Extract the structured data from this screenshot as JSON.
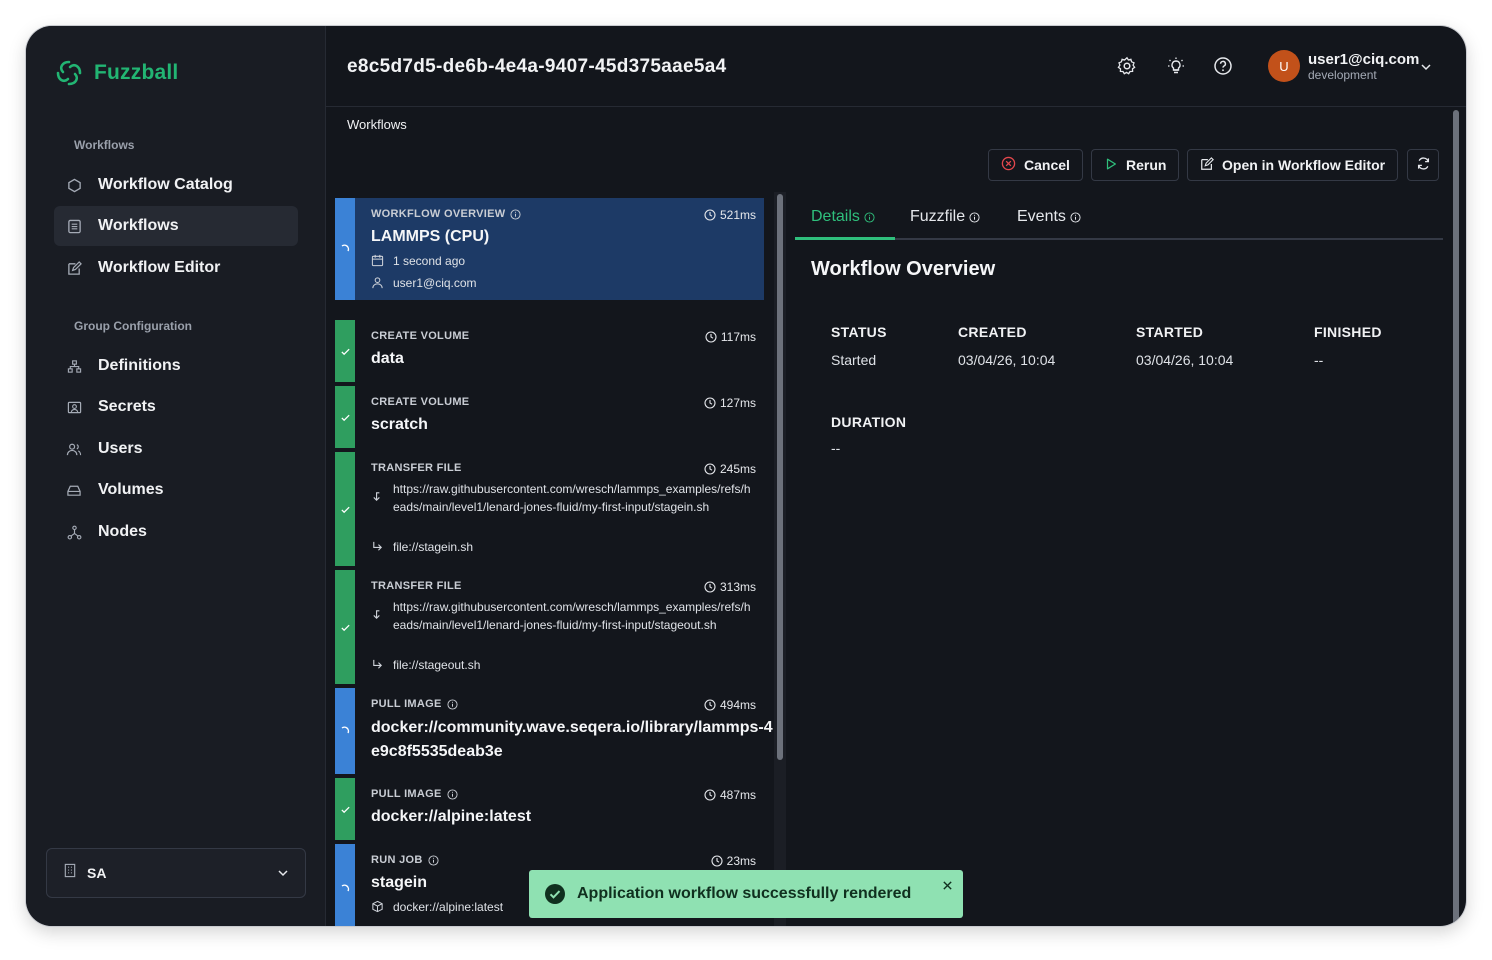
{
  "app": {
    "name": "Fuzzball",
    "brand_color": "#22b573"
  },
  "sidebar": {
    "section_workflows": "Workflows",
    "section_group": "Group Configuration",
    "items": [
      {
        "label": "Workflow Catalog",
        "icon": "hexagon-icon"
      },
      {
        "label": "Workflows",
        "icon": "list-icon",
        "active": true
      },
      {
        "label": "Workflow Editor",
        "icon": "edit-icon"
      },
      {
        "label": "Definitions",
        "icon": "sitemap-icon"
      },
      {
        "label": "Secrets",
        "icon": "secret-icon"
      },
      {
        "label": "Users",
        "icon": "users-icon"
      },
      {
        "label": "Volumes",
        "icon": "hard-drive-icon"
      },
      {
        "label": "Nodes",
        "icon": "nodes-icon"
      }
    ],
    "org": {
      "label": "SA"
    }
  },
  "header": {
    "run_id": "e8c5d7d5-de6b-4e4a-9407-45d375aae5a4",
    "user": {
      "initial": "U",
      "email": "user1@ciq.com",
      "env": "development",
      "avatar_color": "#c2511a"
    }
  },
  "breadcrumb": "Workflows",
  "toolbar": {
    "cancel": "Cancel",
    "rerun": "Rerun",
    "open_editor": "Open in Workflow Editor"
  },
  "steps": [
    {
      "type": "WORKFLOW OVERVIEW",
      "duration": "521ms",
      "title": "LAMMPS (CPU)",
      "created": "1 second ago",
      "user": "user1@ciq.com",
      "status": "running"
    },
    {
      "type": "CREATE VOLUME",
      "duration": "117ms",
      "title": "data",
      "status": "done"
    },
    {
      "type": "CREATE VOLUME",
      "duration": "127ms",
      "title": "scratch",
      "status": "done"
    },
    {
      "type": "TRANSFER FILE",
      "duration": "245ms",
      "source": "https://raw.githubusercontent.com/wresch/lammps_examples/refs/heads/main/level1/lenard-jones-fluid/my-first-input/stagein.sh",
      "dest": "file://stagein.sh",
      "status": "done"
    },
    {
      "type": "TRANSFER FILE",
      "duration": "313ms",
      "source": "https://raw.githubusercontent.com/wresch/lammps_examples/refs/heads/main/level1/lenard-jones-fluid/my-first-input/stageout.sh",
      "dest": "file://stageout.sh",
      "status": "done"
    },
    {
      "type": "PULL IMAGE",
      "duration": "494ms",
      "title": "docker://community.wave.seqera.io/library/lammps-4e9c8f5535deab3e",
      "status": "running"
    },
    {
      "type": "PULL IMAGE",
      "duration": "487ms",
      "title": "docker://alpine:latest",
      "status": "done"
    },
    {
      "type": "RUN JOB",
      "duration": "23ms",
      "title": "stagein",
      "image": "docker://alpine:latest",
      "status": "running"
    }
  ],
  "tabs": [
    "Details",
    "Fuzzfile",
    "Events"
  ],
  "overview": {
    "title": "Workflow Overview",
    "status_label": "STATUS",
    "status": "Started",
    "created_label": "CREATED",
    "created": "03/04/26, 10:04",
    "started_label": "STARTED",
    "started": "03/04/26, 10:04",
    "finished_label": "FINISHED",
    "finished": "--",
    "duration_label": "DURATION",
    "duration": "--"
  },
  "toast": {
    "message": "Application workflow successfully rendered"
  },
  "colors": {
    "running": "#3b82d6",
    "done": "#2f9e5f",
    "selected": "#1d3a66",
    "accent": "#2fbf7c",
    "toast": "#8fe1b2"
  }
}
